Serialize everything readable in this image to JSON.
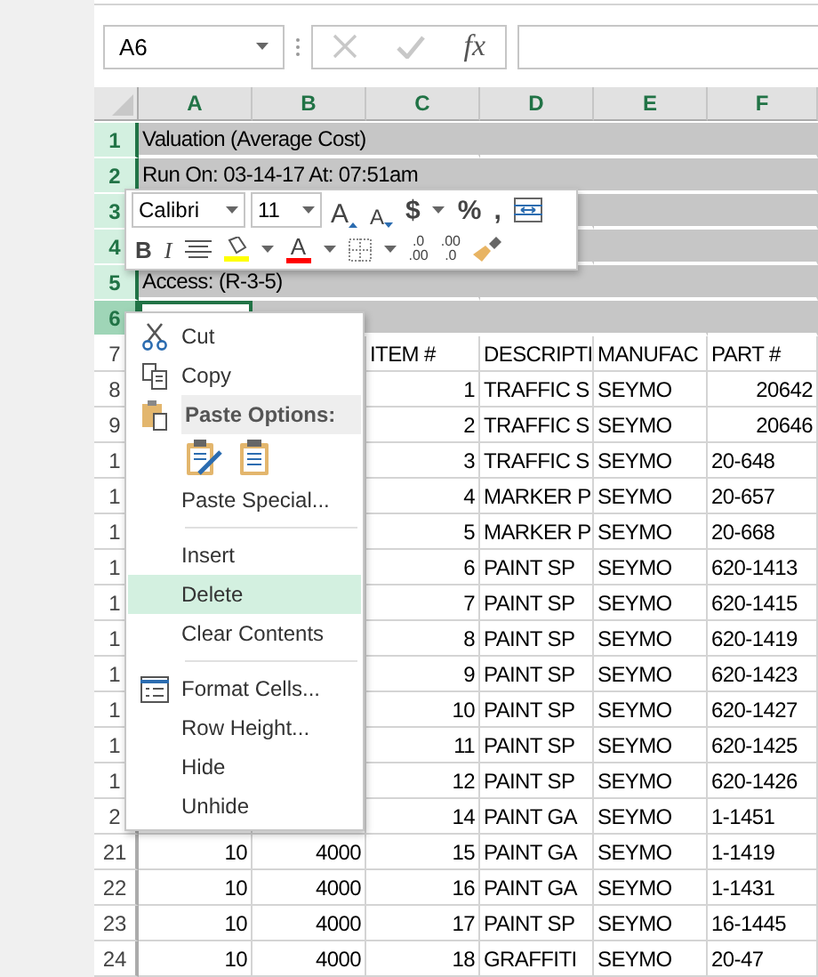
{
  "formula_bar": {
    "name_box": "A6",
    "function_label": "fx"
  },
  "columns": [
    "A",
    "B",
    "C",
    "D",
    "E",
    "F"
  ],
  "rows": [
    {
      "header": "1",
      "selected": true,
      "active": false,
      "cells": [
        {
          "text": "Valuation (Average Cost)",
          "kind": "text"
        },
        null,
        null,
        null,
        null,
        null
      ]
    },
    {
      "header": "2",
      "selected": true,
      "active": false,
      "cells": [
        {
          "text": "Run On: 03-14-17 At: 07:51am",
          "kind": "text"
        },
        null,
        null,
        null,
        null,
        null
      ]
    },
    {
      "header": "3",
      "selected": true,
      "active": false,
      "cells": [
        null,
        null,
        null,
        null,
        null,
        null
      ]
    },
    {
      "header": "4",
      "selected": true,
      "active": false,
      "cells": [
        null,
        null,
        null,
        null,
        null,
        null
      ]
    },
    {
      "header": "5",
      "selected": true,
      "active": false,
      "cells": [
        {
          "text": "Access: (R-3-5)",
          "kind": "text"
        },
        null,
        null,
        null,
        null,
        null
      ]
    },
    {
      "header": "6",
      "selected": true,
      "active": true,
      "cells": [
        null,
        null,
        null,
        null,
        null,
        null
      ]
    },
    {
      "header": "7",
      "selected": false,
      "active": false,
      "cells": [
        null,
        null,
        {
          "text": "ITEM #",
          "kind": "text"
        },
        {
          "text": "DESCRIPTI",
          "kind": "text"
        },
        {
          "text": "MANUFAC",
          "kind": "text"
        },
        {
          "text": "PART #",
          "kind": "text"
        }
      ]
    },
    {
      "header": "8",
      "selected": false,
      "active": false,
      "cells": [
        null,
        null,
        {
          "text": "1",
          "kind": "number"
        },
        {
          "text": "TRAFFIC S",
          "kind": "text"
        },
        {
          "text": "SEYMO",
          "kind": "text"
        },
        {
          "text": "20642",
          "kind": "number"
        }
      ]
    },
    {
      "header": "9",
      "selected": false,
      "active": false,
      "cells": [
        null,
        null,
        {
          "text": "2",
          "kind": "number"
        },
        {
          "text": "TRAFFIC S",
          "kind": "text"
        },
        {
          "text": "SEYMO",
          "kind": "text"
        },
        {
          "text": "20646",
          "kind": "number"
        }
      ]
    },
    {
      "header": "1",
      "selected": false,
      "active": false,
      "cells": [
        null,
        null,
        {
          "text": "3",
          "kind": "number"
        },
        {
          "text": "TRAFFIC S",
          "kind": "text"
        },
        {
          "text": "SEYMO",
          "kind": "text"
        },
        {
          "text": "20-648",
          "kind": "text"
        }
      ]
    },
    {
      "header": "1",
      "selected": false,
      "active": false,
      "cells": [
        null,
        null,
        {
          "text": "4",
          "kind": "number"
        },
        {
          "text": "MARKER P",
          "kind": "text"
        },
        {
          "text": "SEYMO",
          "kind": "text"
        },
        {
          "text": "20-657",
          "kind": "text"
        }
      ]
    },
    {
      "header": "1",
      "selected": false,
      "active": false,
      "cells": [
        null,
        null,
        {
          "text": "5",
          "kind": "number"
        },
        {
          "text": "MARKER P",
          "kind": "text"
        },
        {
          "text": "SEYMO",
          "kind": "text"
        },
        {
          "text": "20-668",
          "kind": "text"
        }
      ]
    },
    {
      "header": "1",
      "selected": false,
      "active": false,
      "cells": [
        null,
        null,
        {
          "text": "6",
          "kind": "number"
        },
        {
          "text": "PAINT SP",
          "kind": "text"
        },
        {
          "text": "SEYMO",
          "kind": "text"
        },
        {
          "text": "620-1413",
          "kind": "text"
        }
      ]
    },
    {
      "header": "1",
      "selected": false,
      "active": false,
      "cells": [
        null,
        null,
        {
          "text": "7",
          "kind": "number"
        },
        {
          "text": "PAINT SP",
          "kind": "text"
        },
        {
          "text": "SEYMO",
          "kind": "text"
        },
        {
          "text": "620-1415",
          "kind": "text"
        }
      ]
    },
    {
      "header": "1",
      "selected": false,
      "active": false,
      "cells": [
        null,
        null,
        {
          "text": "8",
          "kind": "number"
        },
        {
          "text": "PAINT SP",
          "kind": "text"
        },
        {
          "text": "SEYMO",
          "kind": "text"
        },
        {
          "text": "620-1419",
          "kind": "text"
        }
      ]
    },
    {
      "header": "1",
      "selected": false,
      "active": false,
      "cells": [
        null,
        null,
        {
          "text": "9",
          "kind": "number"
        },
        {
          "text": "PAINT SP",
          "kind": "text"
        },
        {
          "text": "SEYMO",
          "kind": "text"
        },
        {
          "text": "620-1423",
          "kind": "text"
        }
      ]
    },
    {
      "header": "1",
      "selected": false,
      "active": false,
      "cells": [
        null,
        null,
        {
          "text": "10",
          "kind": "number"
        },
        {
          "text": "PAINT SP",
          "kind": "text"
        },
        {
          "text": "SEYMO",
          "kind": "text"
        },
        {
          "text": "620-1427",
          "kind": "text"
        }
      ]
    },
    {
      "header": "1",
      "selected": false,
      "active": false,
      "cells": [
        null,
        null,
        {
          "text": "11",
          "kind": "number"
        },
        {
          "text": "PAINT SP",
          "kind": "text"
        },
        {
          "text": "SEYMO",
          "kind": "text"
        },
        {
          "text": "620-1425",
          "kind": "text"
        }
      ]
    },
    {
      "header": "1",
      "selected": false,
      "active": false,
      "cells": [
        null,
        null,
        {
          "text": "12",
          "kind": "number"
        },
        {
          "text": "PAINT SP",
          "kind": "text"
        },
        {
          "text": "SEYMO",
          "kind": "text"
        },
        {
          "text": "620-1426",
          "kind": "text"
        }
      ]
    },
    {
      "header": "2",
      "selected": false,
      "active": false,
      "cells": [
        null,
        null,
        {
          "text": "14",
          "kind": "number"
        },
        {
          "text": "PAINT GA",
          "kind": "text"
        },
        {
          "text": "SEYMO",
          "kind": "text"
        },
        {
          "text": "1-1451",
          "kind": "text"
        }
      ]
    },
    {
      "header": "21",
      "selected": false,
      "active": false,
      "cells": [
        {
          "text": "10",
          "kind": "number"
        },
        {
          "text": "4000",
          "kind": "number"
        },
        {
          "text": "15",
          "kind": "number"
        },
        {
          "text": "PAINT GA",
          "kind": "text"
        },
        {
          "text": "SEYMO",
          "kind": "text"
        },
        {
          "text": "1-1419",
          "kind": "text"
        }
      ]
    },
    {
      "header": "22",
      "selected": false,
      "active": false,
      "cells": [
        {
          "text": "10",
          "kind": "number"
        },
        {
          "text": "4000",
          "kind": "number"
        },
        {
          "text": "16",
          "kind": "number"
        },
        {
          "text": "PAINT GA",
          "kind": "text"
        },
        {
          "text": "SEYMO",
          "kind": "text"
        },
        {
          "text": "1-1431",
          "kind": "text"
        }
      ]
    },
    {
      "header": "23",
      "selected": false,
      "active": false,
      "cells": [
        {
          "text": "10",
          "kind": "number"
        },
        {
          "text": "4000",
          "kind": "number"
        },
        {
          "text": "17",
          "kind": "number"
        },
        {
          "text": "PAINT SP",
          "kind": "text"
        },
        {
          "text": "SEYMO",
          "kind": "text"
        },
        {
          "text": "16-1445",
          "kind": "text"
        }
      ]
    },
    {
      "header": "24",
      "selected": false,
      "active": false,
      "cells": [
        {
          "text": "10",
          "kind": "number"
        },
        {
          "text": "4000",
          "kind": "number"
        },
        {
          "text": "18",
          "kind": "number"
        },
        {
          "text": "GRAFFITI",
          "kind": "text"
        },
        {
          "text": "SEYMO",
          "kind": "text"
        },
        {
          "text": "20-47",
          "kind": "text"
        }
      ]
    }
  ],
  "mini_toolbar": {
    "font": "Calibri",
    "size": "11",
    "row_1": [
      {
        "kind": "grow",
        "label": "A"
      },
      {
        "kind": "shrink",
        "label": "A"
      },
      {
        "kind": "text",
        "label": "$"
      },
      {
        "kind": "caret"
      },
      {
        "kind": "text",
        "label": "%"
      },
      {
        "kind": "text",
        "label": ","
      },
      {
        "kind": "wrap"
      }
    ],
    "row_2": [
      {
        "kind": "bold",
        "label": "B"
      },
      {
        "kind": "italic",
        "label": "I"
      },
      {
        "kind": "align"
      },
      {
        "kind": "fill",
        "color": "#ffff00"
      },
      {
        "kind": "caret"
      },
      {
        "kind": "fontcolor",
        "label": "A",
        "color": "#ff0000"
      },
      {
        "kind": "caret"
      },
      {
        "kind": "borders"
      },
      {
        "kind": "caret"
      },
      {
        "kind": "decimals-more",
        "top": ".0",
        "bottom": ".00"
      },
      {
        "kind": "decimals-less",
        "top": ".00",
        "bottom": ".0"
      },
      {
        "kind": "painter"
      }
    ]
  },
  "context_menu": [
    {
      "kind": "cut",
      "label": "Cut",
      "selected": false
    },
    {
      "kind": "copy",
      "label": "Copy",
      "selected": false
    },
    {
      "kind": "paste-header",
      "label": "Paste Options:",
      "selected": false
    },
    {
      "kind": "paste-icons"
    },
    {
      "kind": "plain",
      "label": "Paste Special...",
      "selected": false
    },
    {
      "kind": "separator"
    },
    {
      "kind": "plain",
      "label": "Insert",
      "selected": false
    },
    {
      "kind": "plain",
      "label": "Delete",
      "selected": true
    },
    {
      "kind": "plain",
      "label": "Clear Contents",
      "selected": false
    },
    {
      "kind": "separator"
    },
    {
      "kind": "format",
      "label": "Format Cells...",
      "selected": false
    },
    {
      "kind": "plain",
      "label": "Row Height...",
      "selected": false
    },
    {
      "kind": "plain",
      "label": "Hide",
      "selected": false
    },
    {
      "kind": "plain",
      "label": "Unhide",
      "selected": false
    }
  ]
}
